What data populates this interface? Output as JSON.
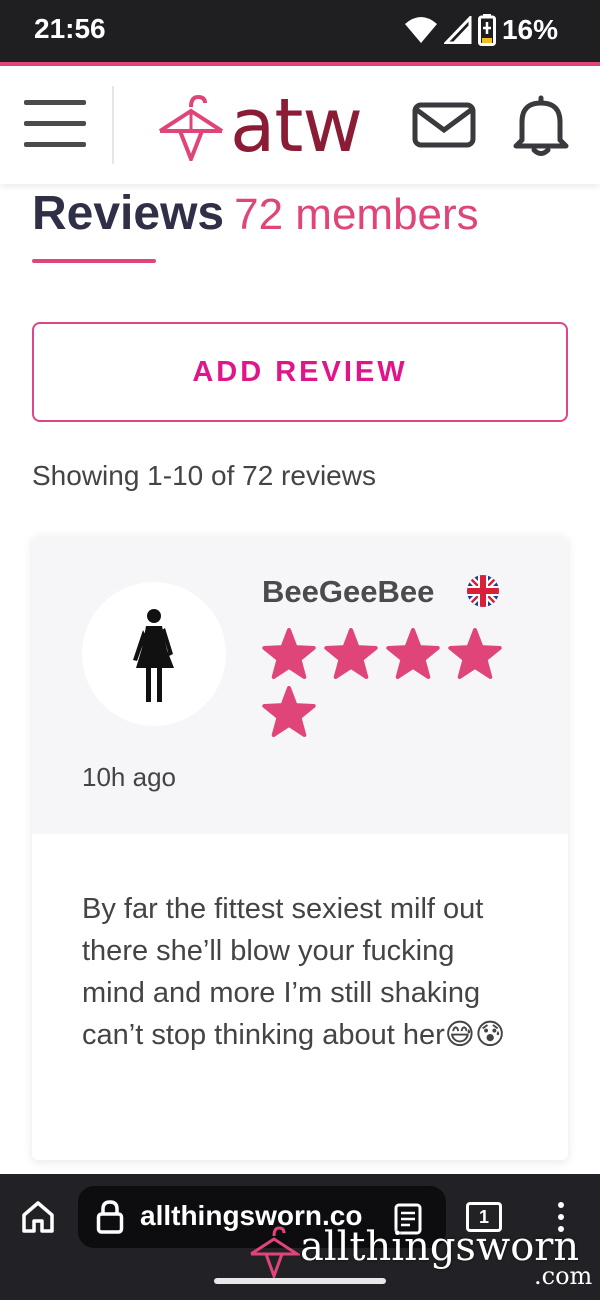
{
  "status_bar": {
    "time": "21:56",
    "battery_percent": "16%"
  },
  "header": {
    "logo_text": "atw",
    "icons": [
      "menu-icon",
      "hanger-logo-icon",
      "mail-icon",
      "bell-icon"
    ]
  },
  "page": {
    "title": "Reviews",
    "member_count": "72 members",
    "add_review_label": "ADD REVIEW",
    "showing_text": "Showing 1-10 of 72 reviews"
  },
  "review": {
    "reviewer": "BeeGeeBee",
    "country_flag": "uk-flag-icon",
    "rating": 5,
    "rating_max": 5,
    "time_ago": "10h ago",
    "text": "By far the fittest sexiest milf out there she’ll blow your fucking mind and more I’m still shaking can’t stop thinking about her😅😰"
  },
  "browser": {
    "url": "allthingsworn.co",
    "tab_count": "1",
    "watermark": "allthingsworn",
    "watermark_suffix": ".com"
  },
  "colors": {
    "accent_pink": "#e0457a",
    "button_pink": "#e0158a",
    "logo_maroon": "#8b1c35",
    "title_dark": "#2f2f47"
  }
}
